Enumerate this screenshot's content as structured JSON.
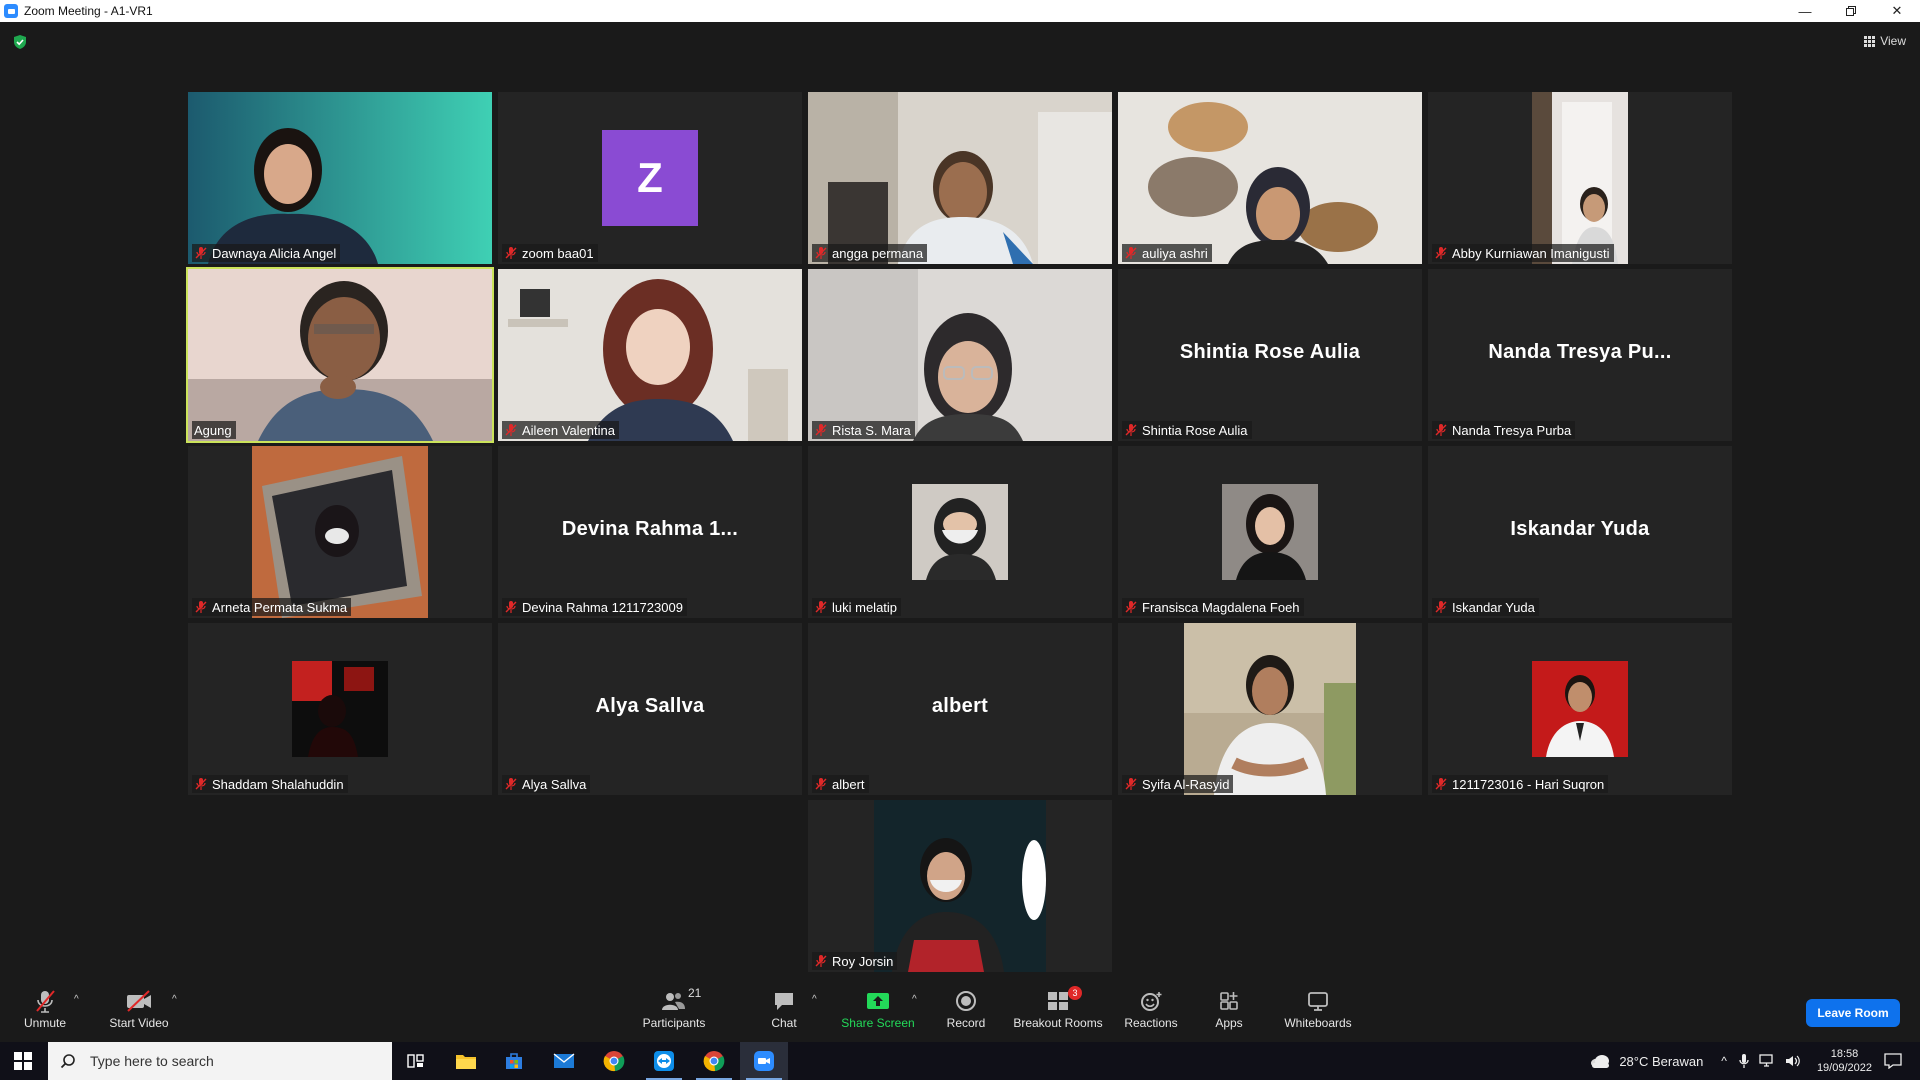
{
  "window": {
    "title": "Zoom Meeting - A1-VR1",
    "controls": [
      "minimize",
      "restore",
      "close"
    ]
  },
  "meeting": {
    "view_label": "View",
    "shield_status": "encrypted",
    "active_speaker": "Agung",
    "tiles": [
      {
        "name": "Dawnaya Alicia Angel",
        "mode": "video",
        "muted": true
      },
      {
        "name": "zoom baa01",
        "mode": "avatar",
        "avatar_letter": "Z",
        "avatar_color": "#8a4bd3",
        "muted": true
      },
      {
        "name": "angga permana",
        "mode": "video",
        "muted": true
      },
      {
        "name": "auliya ashri",
        "mode": "video",
        "muted": true
      },
      {
        "name": "Abby Kurniawan Imanigusti",
        "mode": "video",
        "muted": true
      },
      {
        "name": "Agung",
        "mode": "video",
        "muted": false,
        "active": true
      },
      {
        "name": "Aileen Valentina",
        "mode": "video",
        "muted": true
      },
      {
        "name": "Rista S. Mara",
        "mode": "video",
        "muted": true
      },
      {
        "name": "Shintia Rose Aulia",
        "mode": "name",
        "display_name": "Shintia Rose Aulia",
        "muted": true
      },
      {
        "name": "Nanda Tresya Purba",
        "mode": "name",
        "display_name": "Nanda Tresya Pu...",
        "muted": true
      },
      {
        "name": "Arneta Permata Sukma",
        "mode": "video",
        "muted": true
      },
      {
        "name": "Devina Rahma 1211723009",
        "mode": "name",
        "display_name": "Devina Rahma 1...",
        "muted": true
      },
      {
        "name": "luki melatip",
        "mode": "photo",
        "muted": true
      },
      {
        "name": "Fransisca Magdalena Foeh",
        "mode": "photo",
        "muted": true
      },
      {
        "name": "Iskandar Yuda",
        "mode": "name",
        "display_name": "Iskandar Yuda",
        "muted": true
      },
      {
        "name": "Shaddam Shalahuddin",
        "mode": "photo",
        "muted": true
      },
      {
        "name": "Alya Sallva",
        "mode": "name",
        "display_name": "Alya Sallva",
        "muted": true
      },
      {
        "name": "albert",
        "mode": "name",
        "display_name": "albert",
        "muted": true
      },
      {
        "name": "Syifa Al-Rasyid",
        "mode": "video",
        "muted": true
      },
      {
        "name": "1211723016 - Hari Suqron",
        "mode": "photo",
        "muted": true
      },
      {
        "name": "Roy Jorsin",
        "mode": "video",
        "muted": true
      }
    ]
  },
  "toolbar": {
    "unmute": "Unmute",
    "start_video": "Start Video",
    "participants": "Participants",
    "participants_count": "21",
    "chat": "Chat",
    "share_screen": "Share Screen",
    "record": "Record",
    "breakout_rooms": "Breakout Rooms",
    "breakout_count": "3",
    "reactions": "Reactions",
    "apps": "Apps",
    "whiteboards": "Whiteboards",
    "leave": "Leave Room",
    "colors": {
      "share": "#23d959",
      "leave": "#0e72ed",
      "muted": "#e02828"
    }
  },
  "taskbar": {
    "search_placeholder": "Type here to search",
    "weather": "28°C  Berawan",
    "time": "18:58",
    "date": "19/09/2022",
    "apps": [
      "task-view",
      "file-explorer",
      "microsoft-store",
      "mail",
      "chrome",
      "teamviewer",
      "chrome-profile",
      "zoom"
    ]
  }
}
